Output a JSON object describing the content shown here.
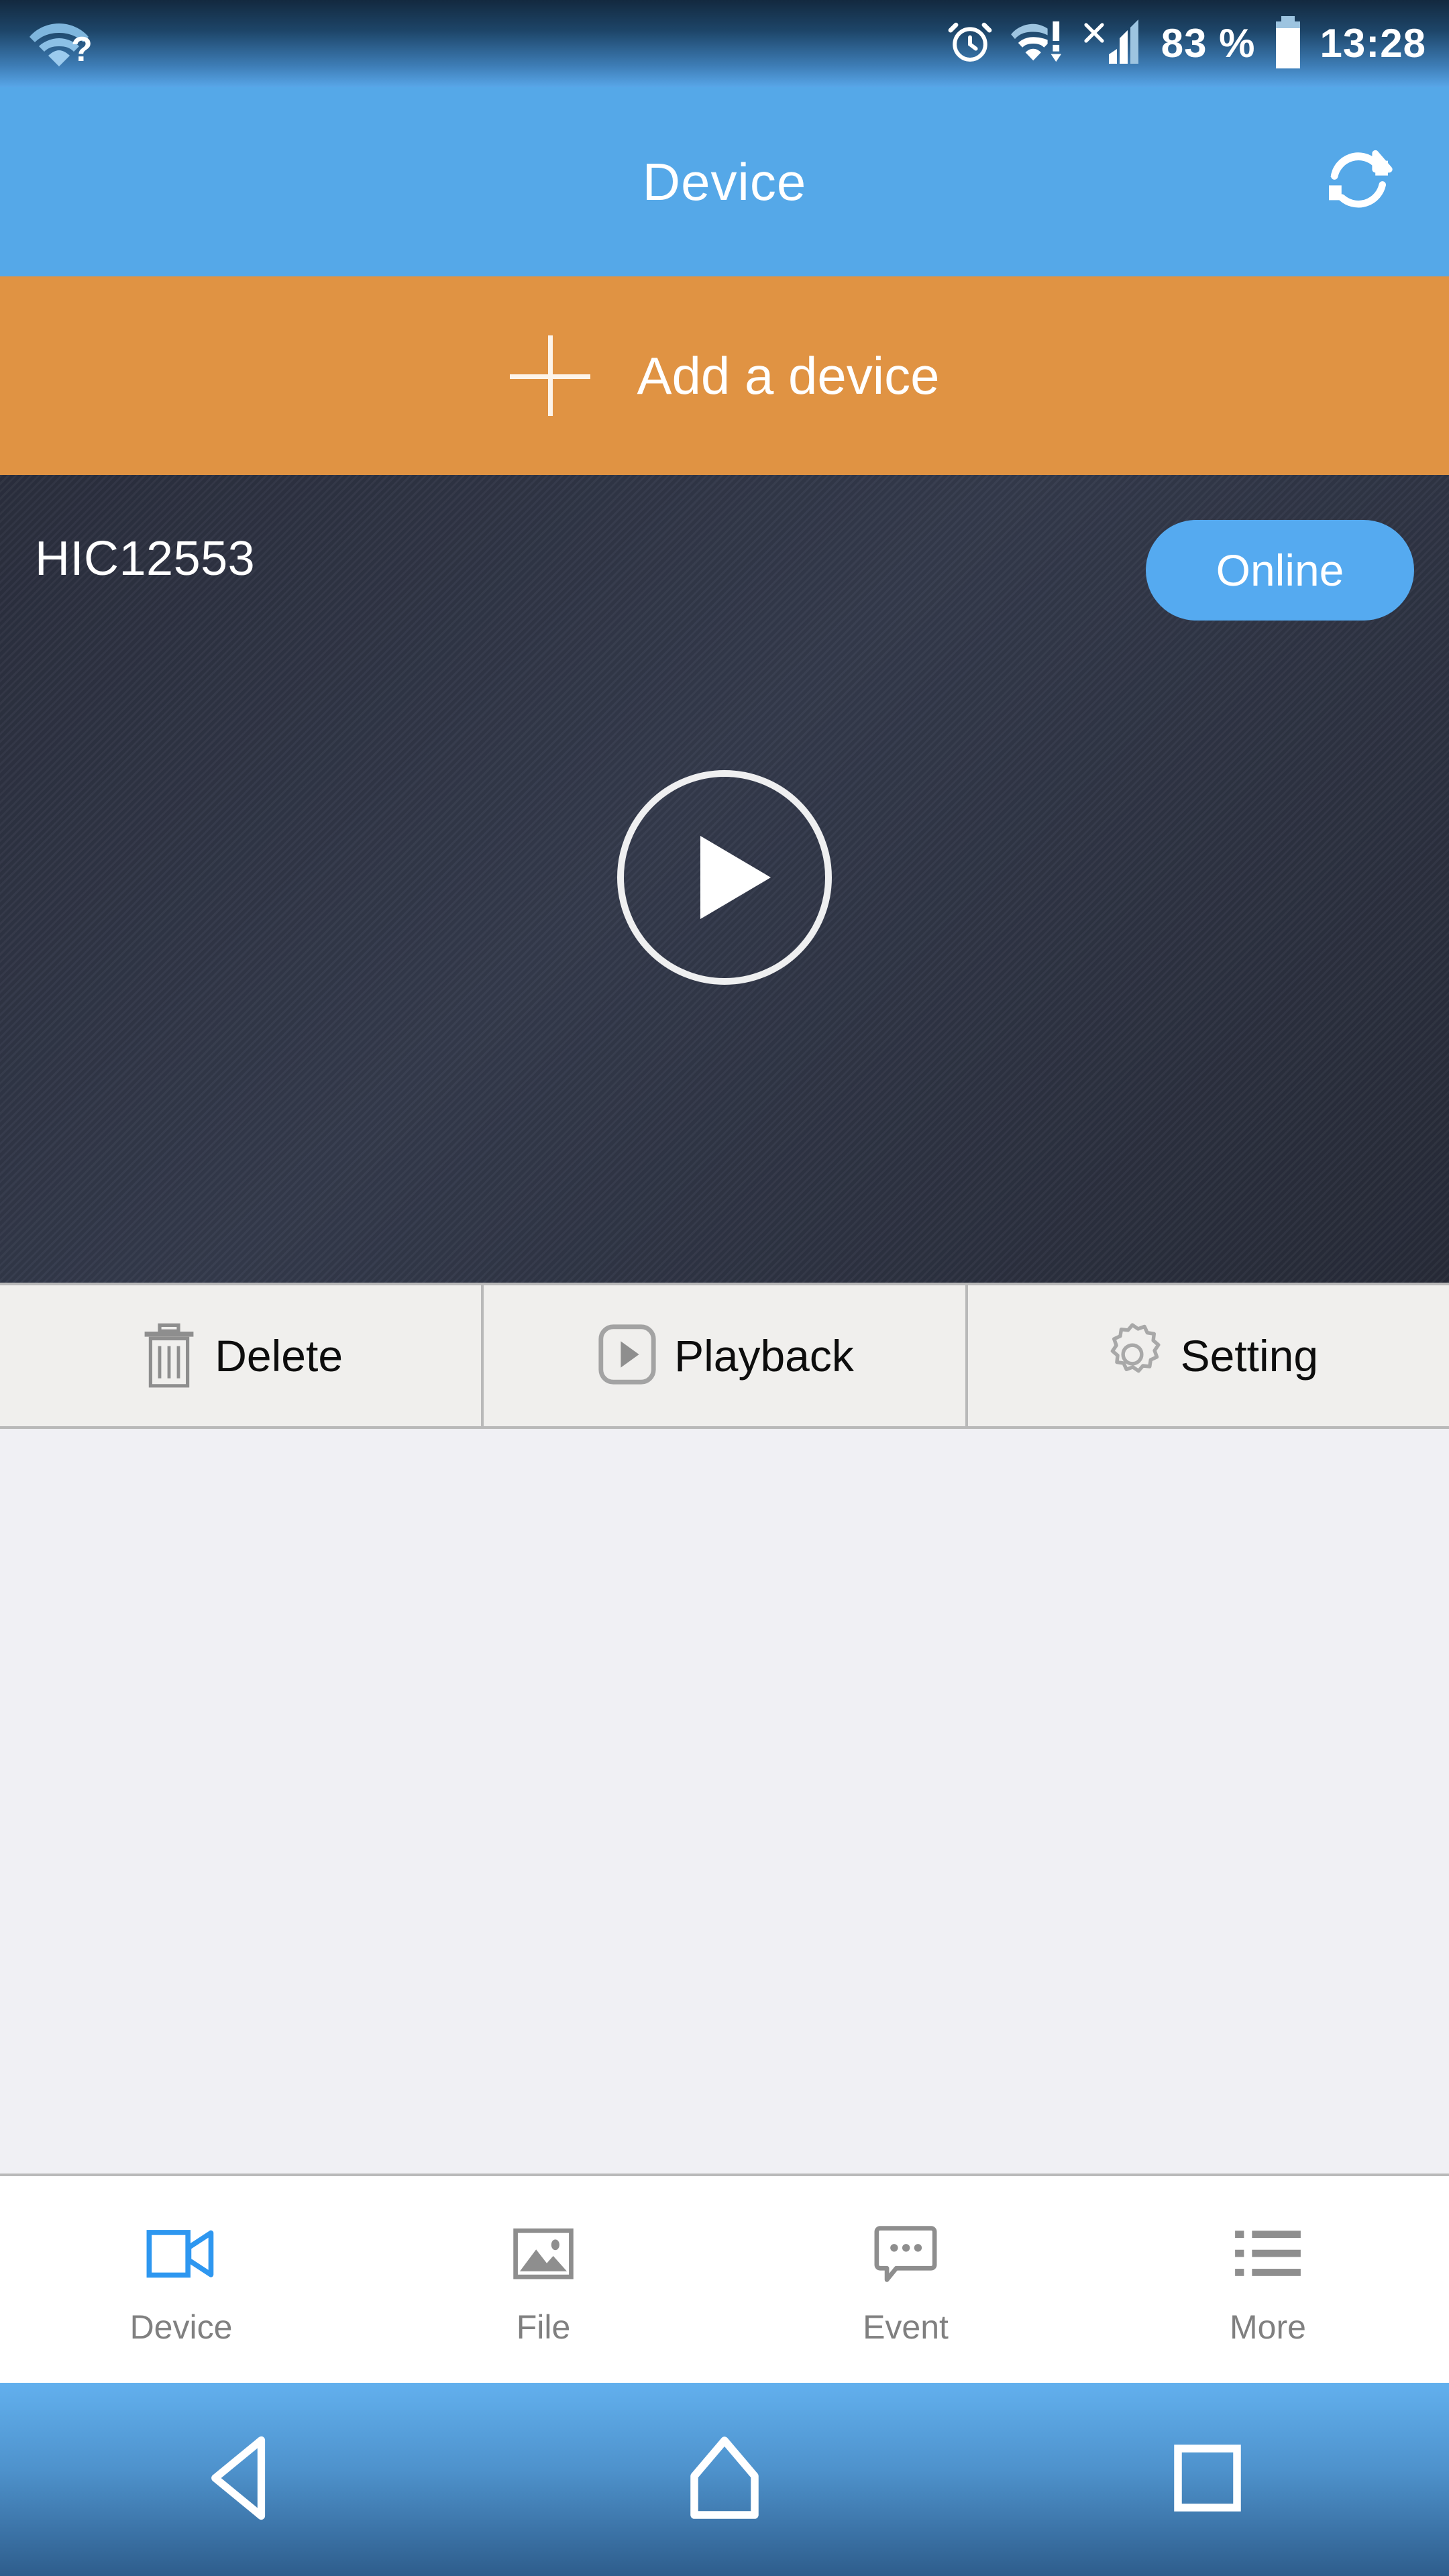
{
  "statusbar": {
    "wifi_question_icon": "wifi-question-icon",
    "alarm_icon": "alarm-clock-icon",
    "wifi_alert_icon": "wifi-alert-icon",
    "no_sim_icon": "no-sim-icon",
    "signal_icon": "cellular-signal-icon",
    "battery_percent": "83 %",
    "battery_icon": "battery-icon",
    "time": "13:28"
  },
  "appbar": {
    "title": "Device",
    "refresh_icon": "refresh-icon"
  },
  "addbar": {
    "plus_icon": "plus-icon",
    "label": "Add a device"
  },
  "device": {
    "name": "HIC12553",
    "status": "Online",
    "play_icon": "play-icon"
  },
  "actions": [
    {
      "label": "Delete",
      "icon": "trash-icon"
    },
    {
      "label": "Playback",
      "icon": "playback-icon"
    },
    {
      "label": "Setting",
      "icon": "gear-icon"
    }
  ],
  "tabs": [
    {
      "label": "Device",
      "icon": "camcorder-icon",
      "active": true
    },
    {
      "label": "File",
      "icon": "image-icon",
      "active": false
    },
    {
      "label": "Event",
      "icon": "speech-bubble-icon",
      "active": false
    },
    {
      "label": "More",
      "icon": "list-icon",
      "active": false
    }
  ],
  "navbar": {
    "back_icon": "back-triangle-icon",
    "home_icon": "home-icon",
    "recents_icon": "recents-square-icon"
  },
  "colors": {
    "accent_blue": "#55a8e8",
    "badge_blue": "#55aaf0",
    "orange": "#e09343",
    "card_dark": "#2b2f3e",
    "tab_active": "#2e97f0",
    "tab_inactive": "#808080"
  }
}
